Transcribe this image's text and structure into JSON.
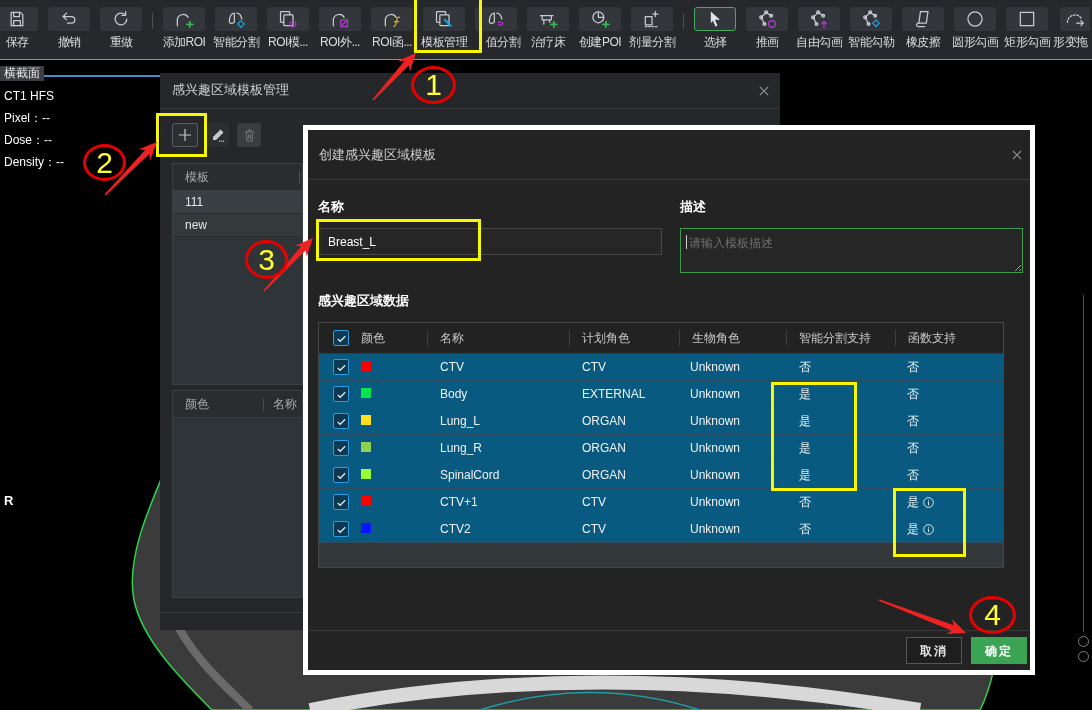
{
  "toolbar": {
    "groups": [
      [
        {
          "label": "保存",
          "selected": false
        },
        {
          "label": "撤销",
          "selected": false
        },
        {
          "label": "重做",
          "selected": false
        }
      ],
      [
        {
          "label": "添加ROI",
          "selected": false
        },
        {
          "label": "智能分割",
          "selected": false
        },
        {
          "label": "ROI模...",
          "selected": false
        },
        {
          "label": "ROI外...",
          "selected": false
        },
        {
          "label": "ROI函...",
          "selected": false
        },
        {
          "label": "模板管理",
          "selected": false
        },
        {
          "label": "值分割",
          "selected": false
        },
        {
          "label": "治疗床",
          "selected": false
        },
        {
          "label": "创建POI",
          "selected": false
        },
        {
          "label": "剂量分割",
          "selected": false
        }
      ],
      [
        {
          "label": "选择",
          "selected": true
        },
        {
          "label": "推画",
          "selected": false
        },
        {
          "label": "自由勾画",
          "selected": false
        },
        {
          "label": "智能勾勒",
          "selected": false
        },
        {
          "label": "橡皮擦",
          "selected": false
        },
        {
          "label": "圆形勾画",
          "selected": false
        },
        {
          "label": "矩形勾画",
          "selected": false
        },
        {
          "label": "形变拖",
          "selected": false
        }
      ]
    ]
  },
  "view_tab": {
    "label": "横截面",
    "selected": true
  },
  "image_info": {
    "lines": [
      "CT1 HFS",
      "Pixel：--",
      "Dose：--",
      "Density：--"
    ],
    "orientation": "R"
  },
  "template_manager": {
    "title": "感兴趣区域模板管理",
    "actions": [
      {
        "kind": "add",
        "disabled": false
      },
      {
        "kind": "edit",
        "disabled": false
      },
      {
        "kind": "delete",
        "disabled": true
      }
    ],
    "template_list": {
      "column": "模板",
      "rows": [
        "111",
        "new"
      ]
    },
    "roi_list": {
      "columns": [
        "颜色",
        "名称"
      ]
    }
  },
  "create_dialog": {
    "title": "创建感兴趣区域模板",
    "name_field": {
      "label": "名称",
      "value": "Breast_L"
    },
    "description_field": {
      "label": "描述",
      "placeholder": "请输入模板描述",
      "focused": true
    },
    "section_title": "感兴趣区域数据",
    "roi_table": {
      "all_checked": true,
      "columns": [
        "颜色",
        "名称",
        "计划角色",
        "生物角色",
        "智能分割支持",
        "函数支持"
      ],
      "rows": [
        {
          "checked": true,
          "color": "#ff0000",
          "name": "CTV",
          "plan_role": "CTV",
          "bio_role": "Unknown",
          "auto_segmentation": "否",
          "function_support": "否",
          "function_info": false
        },
        {
          "checked": true,
          "color": "#00e64d",
          "name": "Body",
          "plan_role": "EXTERNAL",
          "bio_role": "Unknown",
          "auto_segmentation": "是",
          "function_support": "否",
          "function_info": false
        },
        {
          "checked": true,
          "color": "#ffe01a",
          "name": "Lung_L",
          "plan_role": "ORGAN",
          "bio_role": "Unknown",
          "auto_segmentation": "是",
          "function_support": "否",
          "function_info": false
        },
        {
          "checked": true,
          "color": "#92d050",
          "name": "Lung_R",
          "plan_role": "ORGAN",
          "bio_role": "Unknown",
          "auto_segmentation": "是",
          "function_support": "否",
          "function_info": false
        },
        {
          "checked": true,
          "color": "#99ff33",
          "name": "SpinalCord",
          "plan_role": "ORGAN",
          "bio_role": "Unknown",
          "auto_segmentation": "是",
          "function_support": "否",
          "function_info": false
        },
        {
          "checked": true,
          "color": "#ff0000",
          "name": "CTV+1",
          "plan_role": "CTV",
          "bio_role": "Unknown",
          "auto_segmentation": "否",
          "function_support": "是",
          "function_info": true
        },
        {
          "checked": true,
          "color": "#0a14ff",
          "name": "CTV2",
          "plan_role": "CTV",
          "bio_role": "Unknown",
          "auto_segmentation": "否",
          "function_support": "是",
          "function_info": true
        }
      ]
    },
    "buttons": [
      {
        "label": "取消",
        "kind": "secondary"
      },
      {
        "label": "确定",
        "kind": "primary"
      }
    ]
  },
  "annotations": [
    {
      "number": "1"
    },
    {
      "number": "2"
    },
    {
      "number": "3"
    },
    {
      "number": "4"
    }
  ]
}
